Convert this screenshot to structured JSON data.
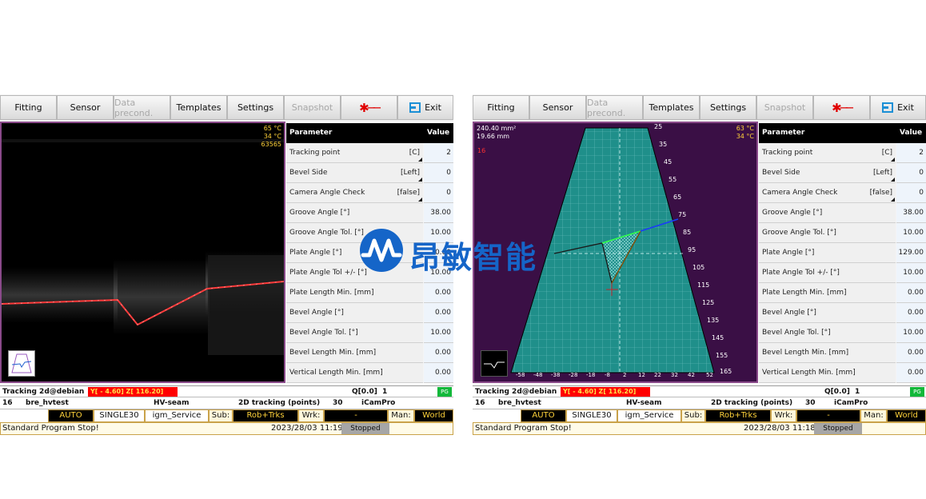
{
  "toolbar": {
    "fitting": "Fitting",
    "sensor": "Sensor",
    "data_precond": "Data precond.",
    "templates": "Templates",
    "settings": "Settings",
    "snapshot": "Snapshot",
    "exit": "Exit"
  },
  "left": {
    "overlay": {
      "t1": "65 °C",
      "t2": "34 °C",
      "t3": "63565"
    },
    "params": [
      {
        "name": "Tracking point",
        "opt": "[C]",
        "value": "2"
      },
      {
        "name": "Bevel Side",
        "opt": "[Left]",
        "value": "0"
      },
      {
        "name": "Camera Angle Check",
        "opt": "[false]",
        "value": "0"
      },
      {
        "name": "Groove Angle [°]",
        "opt": "",
        "value": "38.00"
      },
      {
        "name": "Groove Angle Tol. [°]",
        "opt": "",
        "value": "10.00"
      },
      {
        "name": "Plate Angle [°]",
        "opt": "",
        "value": "0.00"
      },
      {
        "name": "Plate Angle Tol +/- [°]",
        "opt": "",
        "value": "10.00"
      },
      {
        "name": "Plate Length Min. [mm]",
        "opt": "",
        "value": "0.00"
      },
      {
        "name": "Bevel Angle [°]",
        "opt": "",
        "value": "0.00"
      },
      {
        "name": "Bevel Angle Tol. [°]",
        "opt": "",
        "value": "10.00"
      },
      {
        "name": "Bevel Length Min. [mm]",
        "opt": "",
        "value": "0.00"
      },
      {
        "name": "Vertical Length Min. [mm]",
        "opt": "",
        "value": "0.00"
      }
    ],
    "datetime": "2023/28/03 11:19"
  },
  "right": {
    "overlay": {
      "area": "240.40 mm²",
      "len": "19.66 mm",
      "num": "16",
      "t1": "63 °C",
      "t2": "34 °C"
    },
    "scale_right": [
      "25",
      "35",
      "45",
      "55",
      "65",
      "75",
      "85",
      "95",
      "105",
      "115",
      "125",
      "135",
      "145",
      "155",
      "165"
    ],
    "scale_bottom": [
      "-58",
      "-48",
      "-38",
      "-28",
      "-18",
      "-8",
      "2",
      "12",
      "22",
      "32",
      "42",
      "52"
    ],
    "params": [
      {
        "name": "Tracking point",
        "opt": "[C]",
        "value": "2"
      },
      {
        "name": "Bevel Side",
        "opt": "[Left]",
        "value": "0"
      },
      {
        "name": "Camera Angle Check",
        "opt": "[false]",
        "value": "0"
      },
      {
        "name": "Groove Angle [°]",
        "opt": "",
        "value": "38.00"
      },
      {
        "name": "Groove Angle Tol. [°]",
        "opt": "",
        "value": "10.00"
      },
      {
        "name": "Plate Angle [°]",
        "opt": "",
        "value": "129.00"
      },
      {
        "name": "Plate Angle Tol +/- [°]",
        "opt": "",
        "value": "10.00"
      },
      {
        "name": "Plate Length Min. [mm]",
        "opt": "",
        "value": "0.00"
      },
      {
        "name": "Bevel Angle [°]",
        "opt": "",
        "value": "0.00"
      },
      {
        "name": "Bevel Angle Tol. [°]",
        "opt": "",
        "value": "10.00"
      },
      {
        "name": "Bevel Length Min. [mm]",
        "opt": "",
        "value": "0.00"
      },
      {
        "name": "Vertical Length Min. [mm]",
        "opt": "",
        "value": "0.00"
      }
    ],
    "datetime": "2023/28/03 11:18"
  },
  "table_header": {
    "parameter": "Parameter",
    "value": "Value"
  },
  "status": {
    "host": "Tracking 2d@debian",
    "yz": "Y[ -   4.60] Z[  116.20]",
    "q": "Q[0.0]",
    "q_num": "1",
    "pg": "PG",
    "num": "16",
    "program": "bre_hvtest",
    "seam": "HV-seam",
    "mode": "2D tracking (points)",
    "count": "30",
    "cam": "iCamPro",
    "auto": "AUTO",
    "single": "SINGLE30",
    "service": "igm_Service",
    "sub_label": "Sub:",
    "sub_val": "Rob+Trks",
    "wrk_label": "Wrk:",
    "wrk_val": "-",
    "man_label": "Man:",
    "man_val": "World",
    "message": "Standard Program Stop!",
    "state": "Stopped"
  },
  "logo": {
    "text": "昂敏智能"
  },
  "colors": {
    "accent_red": "#ff0000",
    "pg_green": "#12b83a",
    "view_border": "#8a4a8a",
    "teal": "#1f8f8a",
    "logo_blue": "#1565c8"
  }
}
